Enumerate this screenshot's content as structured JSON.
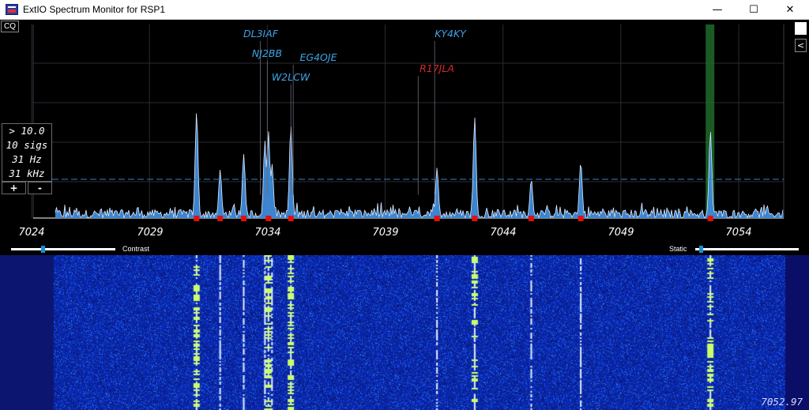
{
  "window": {
    "title": "ExtIO Spectrum Monitor for RSP1",
    "minimize": "—",
    "maximize": "☐",
    "close": "✕"
  },
  "toolbar": {
    "cq_label": "CQ",
    "side_toggle": "<"
  },
  "stats": {
    "threshold": "> 10.0",
    "signals": "10 sigs",
    "bin_width": "31 Hz",
    "span": "31 kHz",
    "plus": "+",
    "minus": "-"
  },
  "sliders": {
    "contrast": {
      "label": "Contrast",
      "value": 0.3
    },
    "static": {
      "label": "Static",
      "value": 0.05
    }
  },
  "cursor_frequency": "7052.97",
  "colors": {
    "spectrum_line": "#dce9ff",
    "spectrum_fill": "#3f8bd8",
    "callsign": "#3da4e8",
    "callsign_alert": "#d62828",
    "threshold_line": "#2f83c8",
    "marker": "#e01010",
    "highlight": "#1f6b2b"
  },
  "chart_data": {
    "type": "area",
    "xlabel": "",
    "ylabel": "",
    "xlim": [
      7024,
      7055.5
    ],
    "ylim": [
      0,
      1
    ],
    "ticks": [
      7024,
      7029,
      7034,
      7039,
      7044,
      7049,
      7054
    ],
    "threshold": 0.2,
    "noise_floor": 0.02,
    "peaks": [
      {
        "freq": 7031.0,
        "amp": 0.55
      },
      {
        "freq": 7032.0,
        "amp": 0.25
      },
      {
        "freq": 7033.0,
        "amp": 0.33
      },
      {
        "freq": 7033.9,
        "amp": 0.4
      },
      {
        "freq": 7034.2,
        "amp": 0.28
      },
      {
        "freq": 7034.05,
        "amp": 0.45
      },
      {
        "freq": 7035.0,
        "amp": 0.48
      },
      {
        "freq": 7041.2,
        "amp": 0.26
      },
      {
        "freq": 7042.8,
        "amp": 0.52
      },
      {
        "freq": 7045.2,
        "amp": 0.2
      },
      {
        "freq": 7047.3,
        "amp": 0.29
      },
      {
        "freq": 7052.8,
        "amp": 0.45
      }
    ],
    "markers": [
      7031.0,
      7032.0,
      7033.0,
      7034.05,
      7035.0,
      7041.2,
      7042.8,
      7045.2,
      7047.3,
      7052.8
    ],
    "highlight_freq": 7052.8,
    "callsigns": [
      {
        "call": "DL3IAF",
        "freq": 7033.7,
        "alert": false
      },
      {
        "call": "NJ2BB",
        "freq": 7034.0,
        "alert": false
      },
      {
        "call": "EG4OJE",
        "freq": 7035.1,
        "alert": false
      },
      {
        "call": "W2LCW",
        "freq": 7035.0,
        "alert": false
      },
      {
        "call": "KY4KY",
        "freq": 7041.1,
        "alert": false
      },
      {
        "call": "R17JLA",
        "freq": 7040.4,
        "alert": true
      }
    ]
  }
}
